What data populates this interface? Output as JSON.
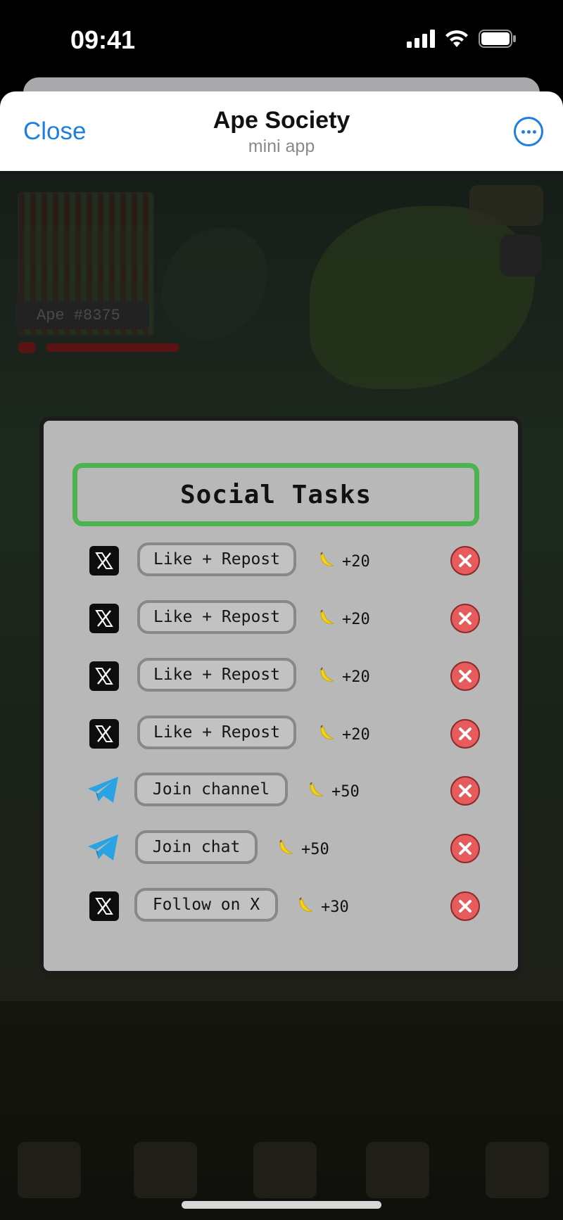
{
  "status_bar": {
    "time": "09:41"
  },
  "header": {
    "close_label": "Close",
    "title": "Ape Society",
    "subtitle": "mini app"
  },
  "background": {
    "ape_name": "Ape #8375"
  },
  "modal": {
    "title": "Social Tasks",
    "tasks": [
      {
        "platform": "x-icon",
        "label": "Like + Repost",
        "reward": "+20",
        "status": "incomplete"
      },
      {
        "platform": "x-icon",
        "label": "Like + Repost",
        "reward": "+20",
        "status": "incomplete"
      },
      {
        "platform": "x-icon",
        "label": "Like + Repost",
        "reward": "+20",
        "status": "incomplete"
      },
      {
        "platform": "x-icon",
        "label": "Like + Repost",
        "reward": "+20",
        "status": "incomplete"
      },
      {
        "platform": "telegram-icon",
        "label": "Join channel",
        "reward": "+50",
        "status": "incomplete"
      },
      {
        "platform": "telegram-icon",
        "label": "Join chat",
        "reward": "+50",
        "status": "incomplete"
      },
      {
        "platform": "x-icon",
        "label": "Follow on X",
        "reward": "+30",
        "status": "incomplete"
      }
    ]
  },
  "colors": {
    "accent_blue": "#1e7fe0",
    "title_border": "#4db34f",
    "status_red": "#e65b5b",
    "banana": "#f2d21b"
  }
}
